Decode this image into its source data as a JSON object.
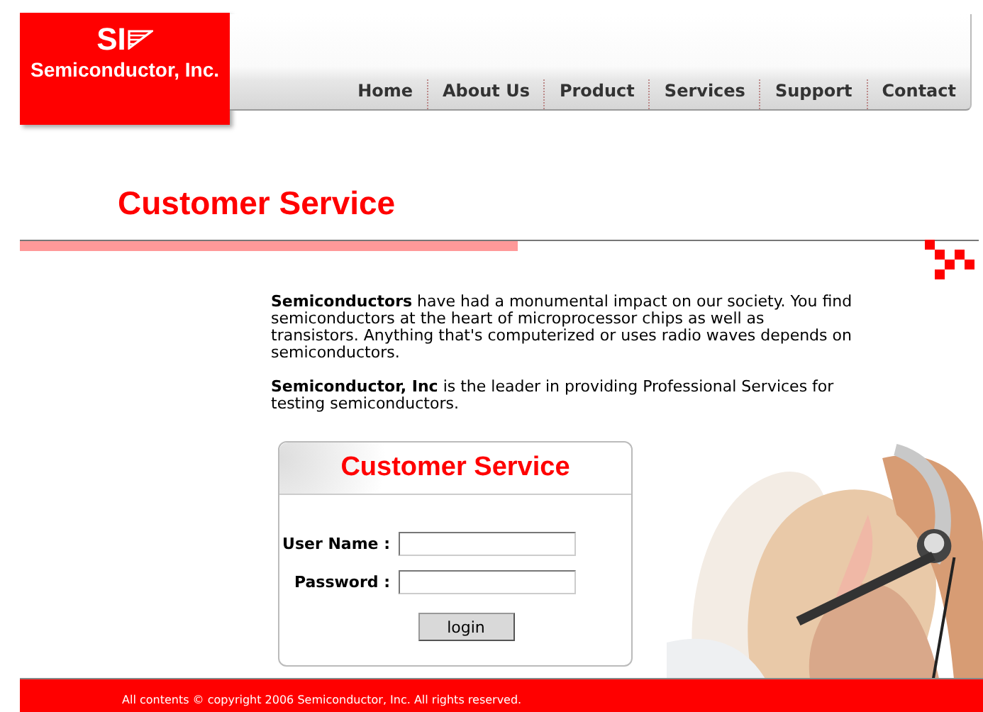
{
  "logo": {
    "mark": "SI",
    "name": "Semiconductor, Inc."
  },
  "nav": [
    {
      "label": "Home"
    },
    {
      "label": "About Us"
    },
    {
      "label": "Product"
    },
    {
      "label": "Services"
    },
    {
      "label": "Support"
    },
    {
      "label": "Contact"
    }
  ],
  "page_title": "Customer Service",
  "paragraphs": [
    "**Semiconductors** have had a monumental impact on our society. You find semiconductors at the heart of microprocessor chips as well as transistors. Anything that's computerized or uses radio waves depends on semiconductors.",
    "**Semiconductor, Inc** is the leader in providing Professional Services for testing semiconductors."
  ],
  "login": {
    "title": "Customer Service",
    "fields": [
      {
        "label": "User Name :"
      },
      {
        "label": "Password :"
      }
    ],
    "button": "login"
  },
  "footer": "All contents © copyright 2006 Semiconductor, Inc. All rights reserved."
}
